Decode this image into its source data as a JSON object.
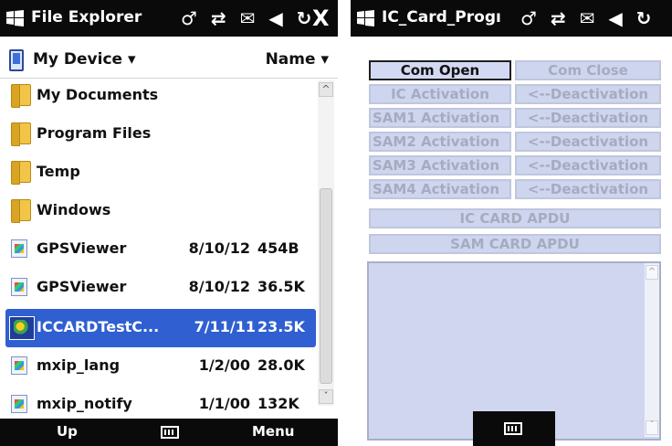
{
  "left": {
    "title": "File Explorer",
    "status_icons": "♂ ⇄ ✉ ◀ ↻",
    "close_glyph": "X",
    "location": "My Device",
    "sort": "Name",
    "folders": [
      {
        "name": "My Documents"
      },
      {
        "name": "Program Files"
      },
      {
        "name": "Temp"
      },
      {
        "name": "Windows"
      }
    ],
    "files": [
      {
        "name": "GPSViewer",
        "date": "8/10/12",
        "size": "454B"
      },
      {
        "name": "GPSViewer",
        "date": "8/10/12",
        "size": "36.5K"
      },
      {
        "name": "ICCARDTestC...",
        "date": "7/11/11",
        "size": "23.5K"
      },
      {
        "name": "mxip_lang",
        "date": "1/2/00",
        "size": "28.0K"
      },
      {
        "name": "mxip_notify",
        "date": "1/1/00",
        "size": "132K"
      }
    ],
    "menu": {
      "left": "Up",
      "right": "Menu"
    }
  },
  "right": {
    "title": "IC_Card_Progı",
    "status_icons": "♂ ⇄ ✉ ◀ ↻",
    "buttons": {
      "com_open": "Com Open",
      "com_close": "Com Close",
      "ic_activation": "IC  Activation",
      "ic_deactivation": "<--Deactivation",
      "sam1_activation": "SAM1  Activation",
      "sam1_deactivation": "<--Deactivation",
      "sam2_activation": "SAM2  Activation",
      "sam2_deactivation": "<--Deactivation",
      "sam3_activation": "SAM3  Activation",
      "sam3_deactivation": "<--Deactivation",
      "sam4_activation": "SAM4  Activation",
      "sam4_deactivation": "<--Deactivation",
      "ic_card_apdu": "IC CARD APDU",
      "sam_card_apdu": "SAM CARD APDU"
    },
    "apdu_text": ""
  },
  "colors": {
    "bar": "#0a0a0a",
    "selection": "#2f5fd0",
    "button_fill": "#ced5ef",
    "button_text_disabled": "#a6abbf"
  }
}
